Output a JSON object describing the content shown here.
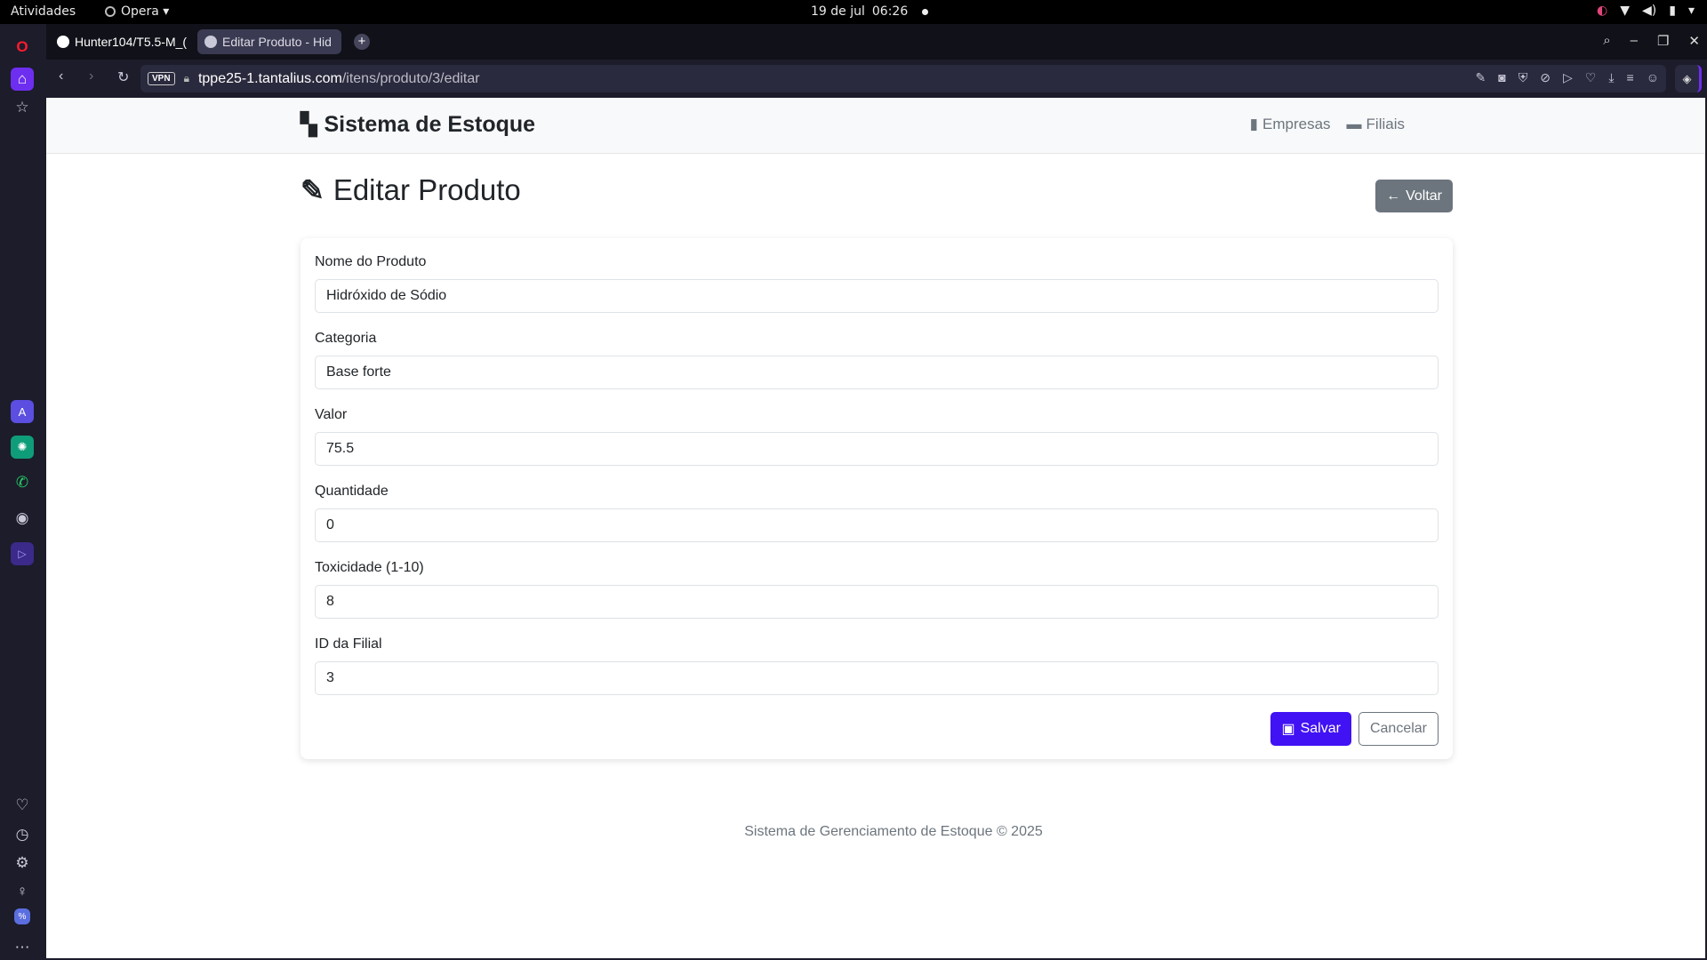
{
  "system_bar": {
    "activities": "Atividades",
    "app_name": "Opera ▾",
    "date": "19 de jul",
    "time": "06:26"
  },
  "browser": {
    "tabs": [
      {
        "label": "Hunter104/T5.5-M_("
      },
      {
        "label": "Editar Produto - Hid"
      }
    ],
    "new_tab": "+",
    "vpn_label": "VPN",
    "url_host": "tppe25-1.tantalius.com",
    "url_path": "/itens/produto/3/editar"
  },
  "site": {
    "brand": "Sistema de Estoque",
    "nav": [
      {
        "label": "Empresas"
      },
      {
        "label": "Filiais"
      }
    ]
  },
  "page": {
    "title": "Editar Produto",
    "back_button": "Voltar",
    "fields": [
      {
        "label": "Nome do Produto",
        "value": "Hidróxido de Sódio"
      },
      {
        "label": "Categoria",
        "value": "Base forte"
      },
      {
        "label": "Valor",
        "value": "75.5"
      },
      {
        "label": "Quantidade",
        "value": "0"
      },
      {
        "label": "Toxicidade (1-10)",
        "value": "8"
      },
      {
        "label": "ID da Filial",
        "value": "3"
      }
    ],
    "save_button": "Salvar",
    "cancel_button": "Cancelar"
  },
  "footer": "Sistema de Gerenciamento de Estoque © 2025",
  "colors": {
    "primary": "#4112f4",
    "secondary": "#6c757d",
    "opera_accent": "#6e2ef0"
  }
}
